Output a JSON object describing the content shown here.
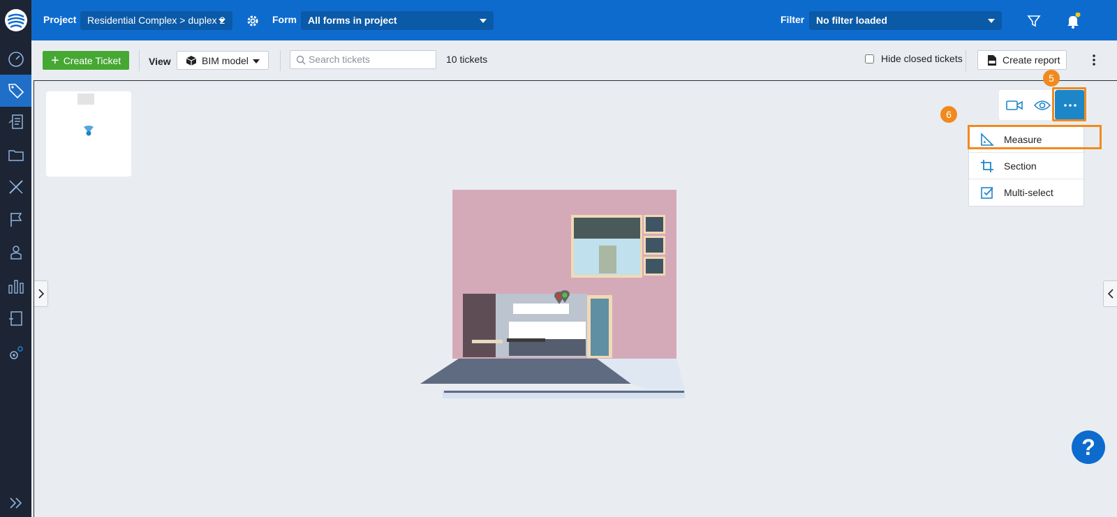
{
  "topbar": {
    "project_label": "Project",
    "project_value": "Residential Complex > duplex 2",
    "form_label": "Form",
    "form_value": "All forms in project",
    "filter_label": "Filter",
    "filter_value": "No filter loaded"
  },
  "toolbar": {
    "create_ticket_label": "Create Ticket",
    "view_label": "View",
    "view_value": "BIM model",
    "search_placeholder": "Search tickets",
    "ticket_count": "10 tickets",
    "hide_closed_label": "Hide closed tickets",
    "hide_closed_checked": false,
    "create_report_label": "Create report"
  },
  "sidebar": {
    "items": [
      {
        "icon": "dashboard-icon",
        "active": false
      },
      {
        "icon": "tickets-tag-icon",
        "active": true
      },
      {
        "icon": "forms-document-icon",
        "active": false
      },
      {
        "icon": "folder-icon",
        "active": false
      },
      {
        "icon": "ruler-pencil-icon",
        "active": false
      },
      {
        "icon": "flag-icon",
        "active": false
      },
      {
        "icon": "user-icon",
        "active": false
      },
      {
        "icon": "bar-chart-icon",
        "active": false
      },
      {
        "icon": "clipboard-icon",
        "active": false
      },
      {
        "icon": "settings-gears-icon",
        "active": false
      }
    ]
  },
  "viewer": {
    "badge_more": "5",
    "badge_menu": "6",
    "menu_items": [
      {
        "label": "Measure",
        "icon": "measure-triangle-icon"
      },
      {
        "label": "Section",
        "icon": "crop-section-icon"
      },
      {
        "label": "Multi-select",
        "icon": "checkbox-icon"
      }
    ],
    "help_label": "?"
  },
  "colors": {
    "brand_blue": "#0e6bce",
    "sidebar_bg": "#1d2433",
    "create_green": "#46a832",
    "highlight_orange": "#f08a1e",
    "tool_blue": "#1c86c9",
    "wall_pink": "#d5aab8"
  }
}
